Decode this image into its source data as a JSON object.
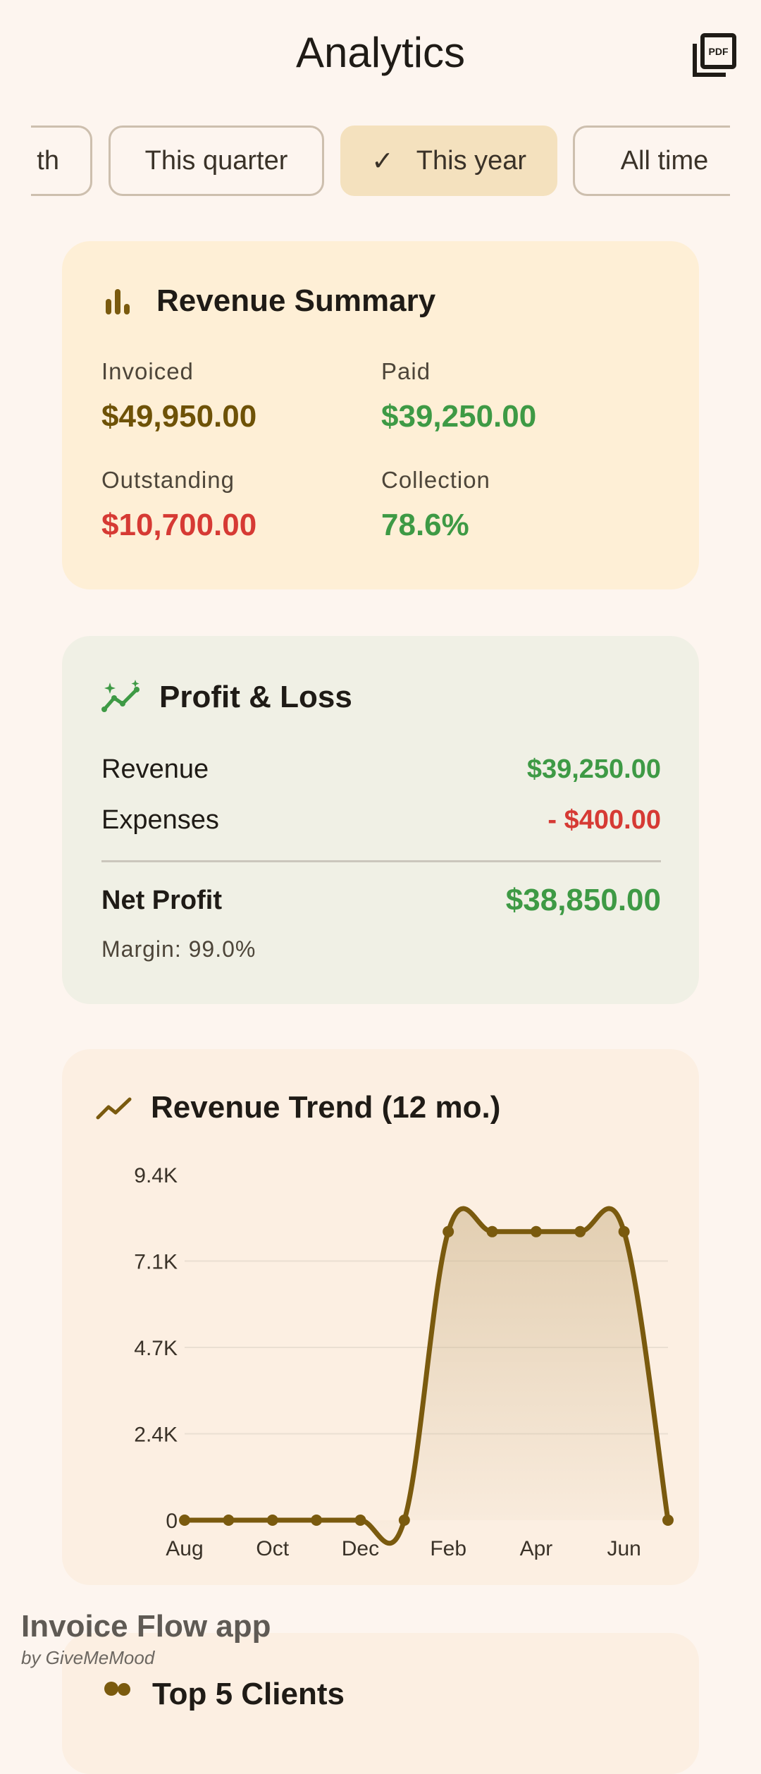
{
  "header": {
    "title": "Analytics",
    "pdf_icon": "pdf-export-icon"
  },
  "filters": {
    "chips": [
      {
        "label": "This month",
        "visible_label": "th",
        "selected": false
      },
      {
        "label": "This quarter",
        "selected": false
      },
      {
        "label": "This year",
        "selected": true
      },
      {
        "label": "All time",
        "selected": false
      }
    ]
  },
  "revenue_summary": {
    "title": "Revenue Summary",
    "icon": "bar-chart-icon",
    "invoiced_label": "Invoiced",
    "invoiced_value": "$49,950.00",
    "paid_label": "Paid",
    "paid_value": "$39,250.00",
    "outstanding_label": "Outstanding",
    "outstanding_value": "$10,700.00",
    "collection_label": "Collection",
    "collection_value": "78.6%"
  },
  "profit_loss": {
    "title": "Profit & Loss",
    "icon": "trending-sparkle-icon",
    "revenue_label": "Revenue",
    "revenue_value": "$39,250.00",
    "expenses_label": "Expenses",
    "expenses_value": "- $400.00",
    "net_profit_label": "Net Profit",
    "net_profit_value": "$38,850.00",
    "margin_text": "Margin: 99.0%"
  },
  "chart_data": {
    "type": "area",
    "title": "Revenue Trend (12 mo.)",
    "xlabel": "",
    "ylabel": "",
    "x": [
      "Aug",
      "Sep",
      "Oct",
      "Nov",
      "Dec",
      "Jan",
      "Feb",
      "Mar",
      "Apr",
      "May",
      "Jun",
      "Jul"
    ],
    "x_tick_labels": [
      "Aug",
      "Oct",
      "Dec",
      "Feb",
      "Apr",
      "Jun"
    ],
    "values": [
      0,
      0,
      0,
      0,
      0,
      0,
      7850,
      7850,
      7850,
      7850,
      7850,
      0
    ],
    "y_tick_labels": [
      "0",
      "2.4K",
      "4.7K",
      "7.1K",
      "9.4K"
    ],
    "y_ticks": [
      0,
      2350,
      4700,
      7050,
      9400
    ],
    "ylim": [
      0,
      9400
    ],
    "grid": true,
    "line_color": "#7a5a0e"
  },
  "top_clients": {
    "title": "Top 5 Clients"
  },
  "footer": {
    "app_name": "Invoice Flow app",
    "byline": "by GiveMeMood"
  },
  "colors": {
    "accent": "#7a5a0e",
    "positive": "#3e9a45",
    "negative": "#d63a34",
    "gold_value": "#6e5207"
  }
}
